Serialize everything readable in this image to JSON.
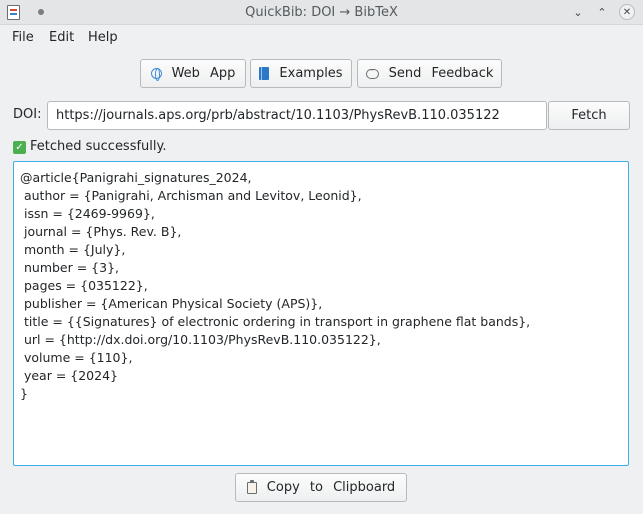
{
  "window": {
    "title": "QuickBib: DOI → BibTeX",
    "buttons": {
      "minimize": "⌄",
      "maximize": "⌃",
      "close": "✕"
    }
  },
  "menu": {
    "items": [
      "File",
      "Edit",
      "Help"
    ]
  },
  "toolbar": {
    "web_app": "Web App",
    "examples": "Examples",
    "send_feedback": "Send Feedback"
  },
  "doi": {
    "label": "DOI:",
    "value": "https://journals.aps.org/prb/abstract/10.1103/PhysRevB.110.035122",
    "fetch_label": "Fetch"
  },
  "status": {
    "text": "Fetched successfully.",
    "icon": "check-icon"
  },
  "bibtex": {
    "lines": [
      "@article{Panigrahi_signatures_2024,",
      " author = {Panigrahi, Archisman and Levitov, Leonid},",
      " issn = {2469-9969},",
      " journal = {Phys. Rev. B},",
      " month = {July},",
      " number = {3},",
      " pages = {035122},",
      " publisher = {American Physical Society (APS)},",
      " title = {{Signatures} of electronic ordering in transport in graphene flat bands},",
      " url = {http://dx.doi.org/10.1103/PhysRevB.110.035122},",
      " volume = {110},",
      " year = {2024}",
      "}"
    ]
  },
  "copy": {
    "label": "Copy to Clipboard"
  },
  "colors": {
    "accent": "#3daee9",
    "success": "#4caf50",
    "background": "#eff0f1"
  }
}
